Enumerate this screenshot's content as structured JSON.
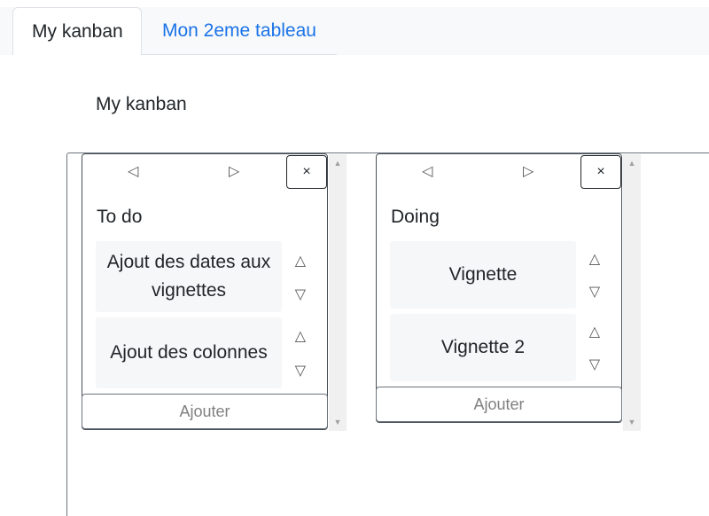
{
  "tabs": [
    {
      "label": "My kanban"
    },
    {
      "label": "Mon 2eme tableau"
    }
  ],
  "board": {
    "title": "My kanban"
  },
  "icons": {
    "prev": "◁",
    "next": "▷",
    "close": "×",
    "up": "△",
    "down": "▽",
    "sb_up": "▲",
    "sb_down": "▼"
  },
  "columns": [
    {
      "title": "To do",
      "cards": [
        {
          "text": "Ajout des dates aux vignettes"
        },
        {
          "text": "Ajout des colonnes"
        }
      ],
      "add_label": "Ajouter"
    },
    {
      "title": "Doing",
      "cards": [
        {
          "text": "Vignette"
        },
        {
          "text": "Vignette 2"
        }
      ],
      "add_label": "Ajouter"
    }
  ],
  "colors": {
    "link": "#1a73e8",
    "border": "#495057"
  }
}
